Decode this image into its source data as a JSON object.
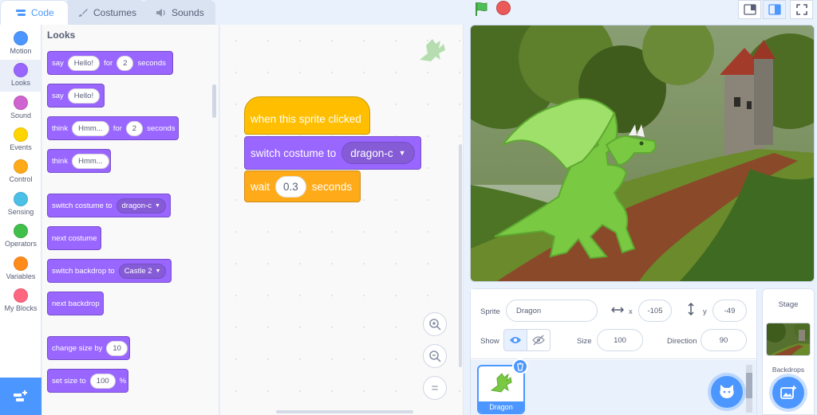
{
  "tabs": {
    "code": "Code",
    "costumes": "Costumes",
    "sounds": "Sounds"
  },
  "categories": [
    {
      "label": "Motion",
      "color": "#4c97ff"
    },
    {
      "label": "Looks",
      "color": "#9966ff"
    },
    {
      "label": "Sound",
      "color": "#cf63cf"
    },
    {
      "label": "Events",
      "color": "#ffd500"
    },
    {
      "label": "Control",
      "color": "#ffab19"
    },
    {
      "label": "Sensing",
      "color": "#4cbfe6"
    },
    {
      "label": "Operators",
      "color": "#40bf4a"
    },
    {
      "label": "Variables",
      "color": "#ff8c1a"
    },
    {
      "label": "My Blocks",
      "color": "#ff6680"
    }
  ],
  "palette": {
    "title": "Looks",
    "say_for": {
      "say": "say",
      "msg": "Hello!",
      "for": "for",
      "secs": "2",
      "seconds": "seconds"
    },
    "say": {
      "say": "say",
      "msg": "Hello!"
    },
    "think_for": {
      "think": "think",
      "msg": "Hmm...",
      "for": "for",
      "secs": "2",
      "seconds": "seconds"
    },
    "think": {
      "think": "think",
      "msg": "Hmm..."
    },
    "switch_costume": {
      "label": "switch costume to",
      "value": "dragon-c"
    },
    "next_costume": "next costume",
    "switch_backdrop": {
      "label": "switch backdrop to",
      "value": "Castle 2"
    },
    "next_backdrop": "next backdrop",
    "change_size": {
      "label": "change size by",
      "value": "10"
    },
    "set_size": {
      "label": "set size to",
      "value": "100",
      "unit": "%"
    }
  },
  "script": {
    "hat": "when this sprite clicked",
    "switch_costume": {
      "label": "switch costume to",
      "value": "dragon-c"
    },
    "wait": {
      "label": "wait",
      "value": "0.3",
      "unit": "seconds"
    }
  },
  "zoom": {
    "in": "+",
    "out": "−",
    "reset": "="
  },
  "sprite_info": {
    "sprite_label": "Sprite",
    "sprite_name": "Dragon",
    "x_label": "x",
    "x_value": "-105",
    "y_label": "y",
    "y_value": "-49",
    "show_label": "Show",
    "size_label": "Size",
    "size_value": "100",
    "direction_label": "Direction",
    "direction_value": "90"
  },
  "sprites": [
    {
      "name": "Dragon"
    }
  ],
  "stage_panel": {
    "title": "Stage",
    "backdrops_label": "Backdrops"
  },
  "colors": {
    "accent": "#4c97ff",
    "looks": "#9966ff",
    "events": "#ffbf00",
    "control": "#ffab19"
  }
}
